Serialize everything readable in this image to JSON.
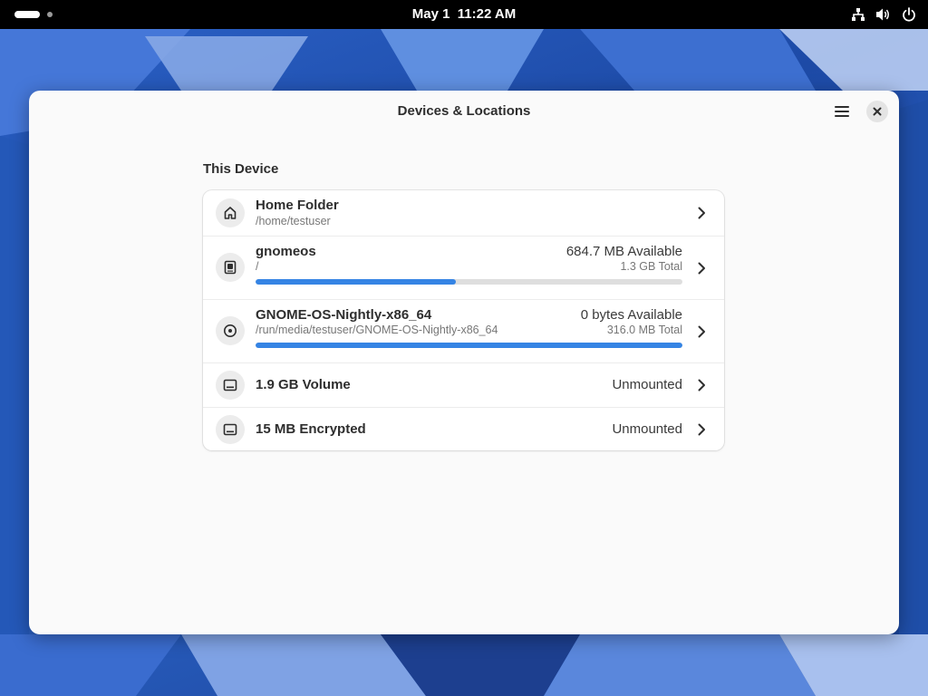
{
  "topbar": {
    "date": "May 1",
    "time": "11:22 AM"
  },
  "window": {
    "title": "Devices & Locations"
  },
  "section": {
    "title": "This Device"
  },
  "locations": [
    {
      "icon": "home-icon",
      "title": "Home Folder",
      "subtitle": "/home/testuser"
    },
    {
      "icon": "drive-icon",
      "title": "gnomeos",
      "subtitle": "/",
      "available": "684.7 MB Available",
      "total": "1.3 GB Total",
      "usage_fraction": 0.47
    },
    {
      "icon": "optical-disc-icon",
      "title": "GNOME-OS-Nightly-x86_64",
      "subtitle": "/run/media/testuser/GNOME-OS-Nightly-x86_64",
      "available": "0 bytes Available",
      "total": "316.0 MB Total",
      "usage_fraction": 1.0
    },
    {
      "icon": "volume-icon",
      "title": "1.9 GB Volume",
      "status": "Unmounted"
    },
    {
      "icon": "volume-icon",
      "title": "15 MB Encrypted",
      "status": "Unmounted"
    }
  ],
  "colors": {
    "accent": "#3584e4",
    "topbar": "#000000",
    "window_bg": "#fafafa"
  }
}
